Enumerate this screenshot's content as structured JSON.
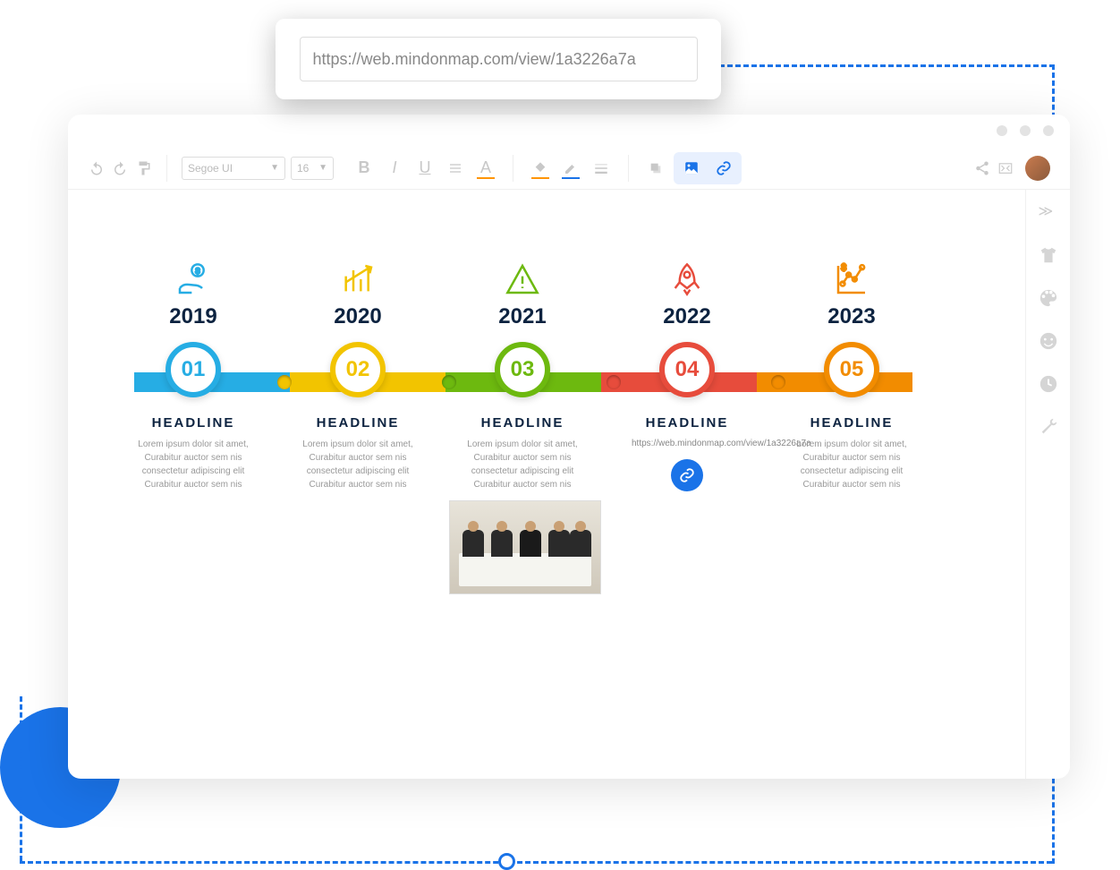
{
  "url_popup": {
    "value": "https://web.mindonmap.com/view/1a3226a7a"
  },
  "toolbar": {
    "font_family": "Segoe UI",
    "font_size": "16"
  },
  "timeline": [
    {
      "year": "2019",
      "num": "01",
      "headline": "HEADLINE",
      "body": "Lorem ipsum dolor sit amet, Curabitur auctor sem nis consectetur adipiscing elit Curabitur auctor sem nis",
      "icon": "hand-money-icon"
    },
    {
      "year": "2020",
      "num": "02",
      "headline": "HEADLINE",
      "body": "Lorem ipsum dolor sit amet, Curabitur auctor sem nis consectetur adipiscing elit Curabitur auctor sem nis",
      "icon": "growth-chart-icon"
    },
    {
      "year": "2021",
      "num": "03",
      "headline": "HEADLINE",
      "body": "Lorem ipsum dolor sit amet, Curabitur auctor sem nis consectetur adipiscing elit Curabitur auctor sem nis",
      "icon": "warning-icon",
      "has_image": true
    },
    {
      "year": "2022",
      "num": "04",
      "headline": "HEADLINE",
      "link_text": "https://web.mindonmap.com/view/1a3226a7a",
      "icon": "rocket-icon",
      "has_link": true
    },
    {
      "year": "2023",
      "num": "05",
      "headline": "HEADLINE",
      "body": "Lorem ipsum dolor sit amet, Curabitur auctor sem nis consectetur adipiscing elit Curabitur auctor sem nis",
      "icon": "analytics-icon"
    }
  ]
}
